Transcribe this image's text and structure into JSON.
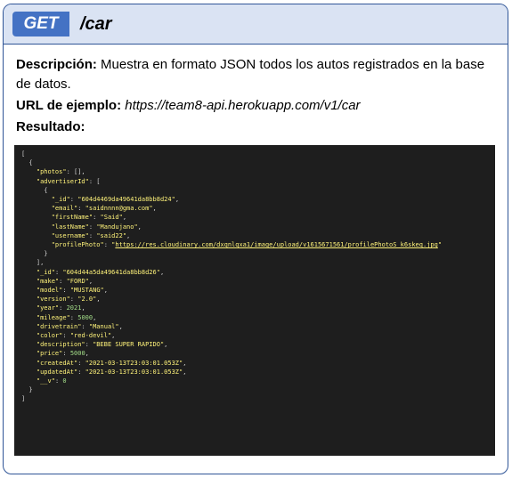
{
  "endpoint": {
    "method": "GET",
    "path": "/car"
  },
  "description": {
    "label": "Descripción:",
    "text": "Muestra en formato JSON todos los autos registrados en la base de datos."
  },
  "example": {
    "label": "URL de ejemplo:",
    "url": "https://team8-api.herokuapp.com/v1/car"
  },
  "result": {
    "label": "Resultado:"
  },
  "code_lines": [
    "[",
    "  {",
    "    \"photos\": [],",
    "    \"advertiserId\": [",
    "      {",
    "        \"_id\": \"604d4469da49641da8bb8d24\",",
    "        \"email\": \"saidnnnn@gma.com\",",
    "        \"firstName\": \"Said\",",
    "        \"lastName\": \"Mandujano\",",
    "        \"username\": \"said22\",",
    "        \"profilePhoto\": \"https://res.cloudinary.com/dxqnlqxa1/image/upload/v1615671561/profilePhotoS_k6skeq.jpg\"",
    "      }",
    "    ],",
    "    \"_id\": \"604d44a5da49641da8bb8d26\",",
    "    \"make\": \"FORD\",",
    "    \"model\": \"MUSTANG\",",
    "    \"version\": \"2.0\",",
    "    \"year\": 2021,",
    "    \"mileage\": 5000,",
    "    \"drivetrain\": \"Manual\",",
    "    \"color\": \"red-devil\",",
    "    \"description\": \"BEBE SUPER RAPIDO\",",
    "    \"price\": 5000,",
    "    \"createdAt\": \"2021-03-13T23:03:01.053Z\",",
    "    \"updatedAt\": \"2021-03-13T23:03:01.053Z\",",
    "    \"__v\": 0",
    "  }",
    "]"
  ],
  "colors": {
    "header_bg": "#dae3f3",
    "method_bg": "#4472c4",
    "border": "#2f5597",
    "code_bg": "#1e1e1e",
    "code_string": "#fff37a",
    "code_number": "#a4de89"
  }
}
